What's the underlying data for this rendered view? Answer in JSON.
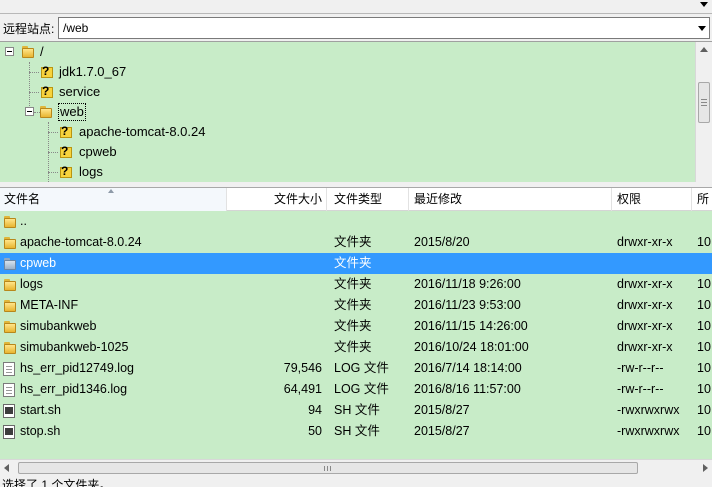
{
  "site": {
    "label": "远程站点:",
    "path": "/web"
  },
  "tree": {
    "items": [
      {
        "label": "/",
        "icon": "folder-icon",
        "level": 0,
        "expanded": true
      },
      {
        "label": "jdk1.7.0_67",
        "icon": "question-icon",
        "level": 1
      },
      {
        "label": "service",
        "icon": "question-icon",
        "level": 1
      },
      {
        "label": "web",
        "icon": "folder-icon",
        "level": 1,
        "expanded": true,
        "selected": true
      },
      {
        "label": "apache-tomcat-8.0.24",
        "icon": "question-icon",
        "level": 2
      },
      {
        "label": "cpweb",
        "icon": "question-icon",
        "level": 2
      },
      {
        "label": "logs",
        "icon": "question-icon",
        "level": 2
      }
    ]
  },
  "columns": {
    "name": "文件名",
    "size": "文件大小",
    "type": "文件类型",
    "modified": "最近修改",
    "permissions": "权限",
    "owner": "所"
  },
  "files": [
    {
      "name": "..",
      "size": "",
      "type": "",
      "modified": "",
      "perm": "",
      "owner": "",
      "icon": "folder"
    },
    {
      "name": "apache-tomcat-8.0.24",
      "size": "",
      "type": "文件夹",
      "modified": "2015/8/20",
      "perm": "drwxr-xr-x",
      "owner": "10",
      "icon": "folder"
    },
    {
      "name": "cpweb",
      "size": "",
      "type": "文件夹",
      "modified": "",
      "perm": "",
      "owner": "",
      "icon": "folder-blue",
      "selected": true
    },
    {
      "name": "logs",
      "size": "",
      "type": "文件夹",
      "modified": "2016/11/18 9:26:00",
      "perm": "drwxr-xr-x",
      "owner": "10",
      "icon": "folder"
    },
    {
      "name": "META-INF",
      "size": "",
      "type": "文件夹",
      "modified": "2016/11/23 9:53:00",
      "perm": "drwxr-xr-x",
      "owner": "10",
      "icon": "folder"
    },
    {
      "name": "simubankweb",
      "size": "",
      "type": "文件夹",
      "modified": "2016/11/15 14:26:00",
      "perm": "drwxr-xr-x",
      "owner": "10",
      "icon": "folder"
    },
    {
      "name": "simubankweb-1025",
      "size": "",
      "type": "文件夹",
      "modified": "2016/10/24 18:01:00",
      "perm": "drwxr-xr-x",
      "owner": "10",
      "icon": "folder"
    },
    {
      "name": "hs_err_pid12749.log",
      "size": "79,546",
      "type": "LOG 文件",
      "modified": "2016/7/14 18:14:00",
      "perm": "-rw-r--r--",
      "owner": "10",
      "icon": "file"
    },
    {
      "name": "hs_err_pid1346.log",
      "size": "64,491",
      "type": "LOG 文件",
      "modified": "2016/8/16 11:57:00",
      "perm": "-rw-r--r--",
      "owner": "10",
      "icon": "file"
    },
    {
      "name": "start.sh",
      "size": "94",
      "type": "SH 文件",
      "modified": "2015/8/27",
      "perm": "-rwxrwxrwx",
      "owner": "10",
      "icon": "sh"
    },
    {
      "name": "stop.sh",
      "size": "50",
      "type": "SH 文件",
      "modified": "2015/8/27",
      "perm": "-rwxrwxrwx",
      "owner": "10",
      "icon": "sh"
    }
  ],
  "status": {
    "text": "选择了 1 个文件夹。"
  },
  "colors": {
    "pane_bg": "#c8ecc8",
    "selection": "#3399ff"
  }
}
